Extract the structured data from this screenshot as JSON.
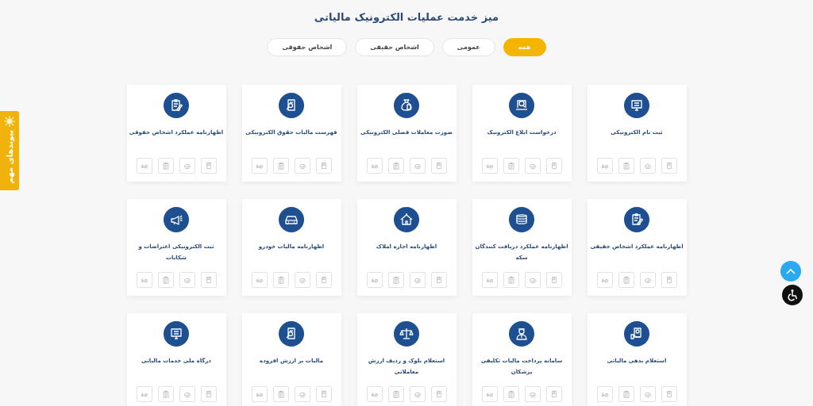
{
  "page_title": "میز خدمت عملیات الکترونیک مالیاتی",
  "filters": [
    {
      "label": "همه",
      "selected": true
    },
    {
      "label": "عمومی",
      "selected": false
    },
    {
      "label": "اشخاص حقیقی",
      "selected": false
    },
    {
      "label": "اشخاص حقوقی",
      "selected": false
    }
  ],
  "services": [
    {
      "title": "ثبت نام الکترونیکی"
    },
    {
      "title": "درخواست ابلاغ الکترونیک"
    },
    {
      "title": "صورت معاملات فصلی الکترونیکی"
    },
    {
      "title": "فهرست مالیات حقوق الکترونیکی"
    },
    {
      "title": "اظهارنامه عملکرد اشخاص حقوقی"
    },
    {
      "title": "اظهارنامه عملکرد اشخاص حقیقی"
    },
    {
      "title": "اظهارنامه عملکرد دریافت کنندگان سکه"
    },
    {
      "title": "اظهارنامه اجاره املاک"
    },
    {
      "title": "اظهارنامه مالیات خودرو"
    },
    {
      "title": "ثبت الکترونیکی اعتراضات و شکایات"
    },
    {
      "title": "استعلام بدهی مالیاتی"
    },
    {
      "title": "سامانه پرداخت مالیات تکلیفی پزشکان"
    },
    {
      "title": "استعلام بلوک و ردیف ارزش معاملاتی"
    },
    {
      "title": "مالیات بر ارزش افزوده"
    },
    {
      "title": "درگاه ملی خدمات مالیاتی"
    }
  ],
  "side_tab": {
    "label": "پیوندهای مهم"
  }
}
